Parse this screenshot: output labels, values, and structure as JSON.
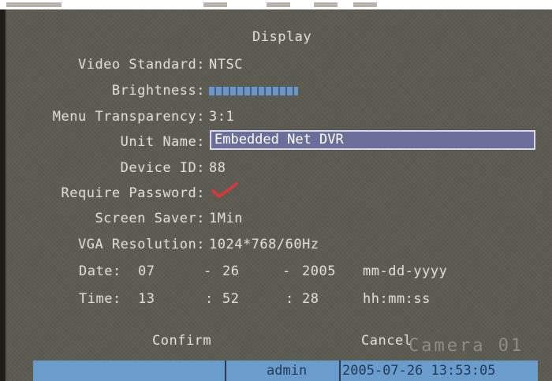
{
  "title": "Display",
  "fields": {
    "video_standard": {
      "label": "Video Standard:",
      "value": "NTSC"
    },
    "brightness": {
      "label": "Brightness:"
    },
    "menu_transparency": {
      "label": "Menu Transparency:",
      "value": "3:1"
    },
    "unit_name": {
      "label": "Unit Name:",
      "value": "Embedded Net DVR"
    },
    "device_id": {
      "label": "Device ID:",
      "value": "88"
    },
    "require_password": {
      "label": "Require Password:",
      "checked": true
    },
    "screen_saver": {
      "label": "Screen Saver:",
      "value": "1Min"
    },
    "vga_resolution": {
      "label": "VGA Resolution:",
      "value": "1024*768/60Hz"
    }
  },
  "date": {
    "label": "Date:",
    "month": "07",
    "sep1": "-",
    "day": "26",
    "sep2": "-",
    "year": "2005",
    "format": "mm-dd-yyyy"
  },
  "time": {
    "label": "Time:",
    "hour": "13",
    "sep1": ":",
    "minute": "52",
    "sep2": ":",
    "second": "28",
    "format": "hh:mm:ss"
  },
  "buttons": {
    "confirm": "Confirm",
    "cancel": "Cancel"
  },
  "watermark": "Camera 01",
  "status_bar": {
    "user": "admin",
    "datetime": "2005-07-26 13:53:05"
  },
  "colors": {
    "panel": "#5c5b52",
    "text": "#dedcd2",
    "field_bg": "#6c6e9a",
    "check": "#d23a3a",
    "status_bar": "#6a9ccc"
  }
}
